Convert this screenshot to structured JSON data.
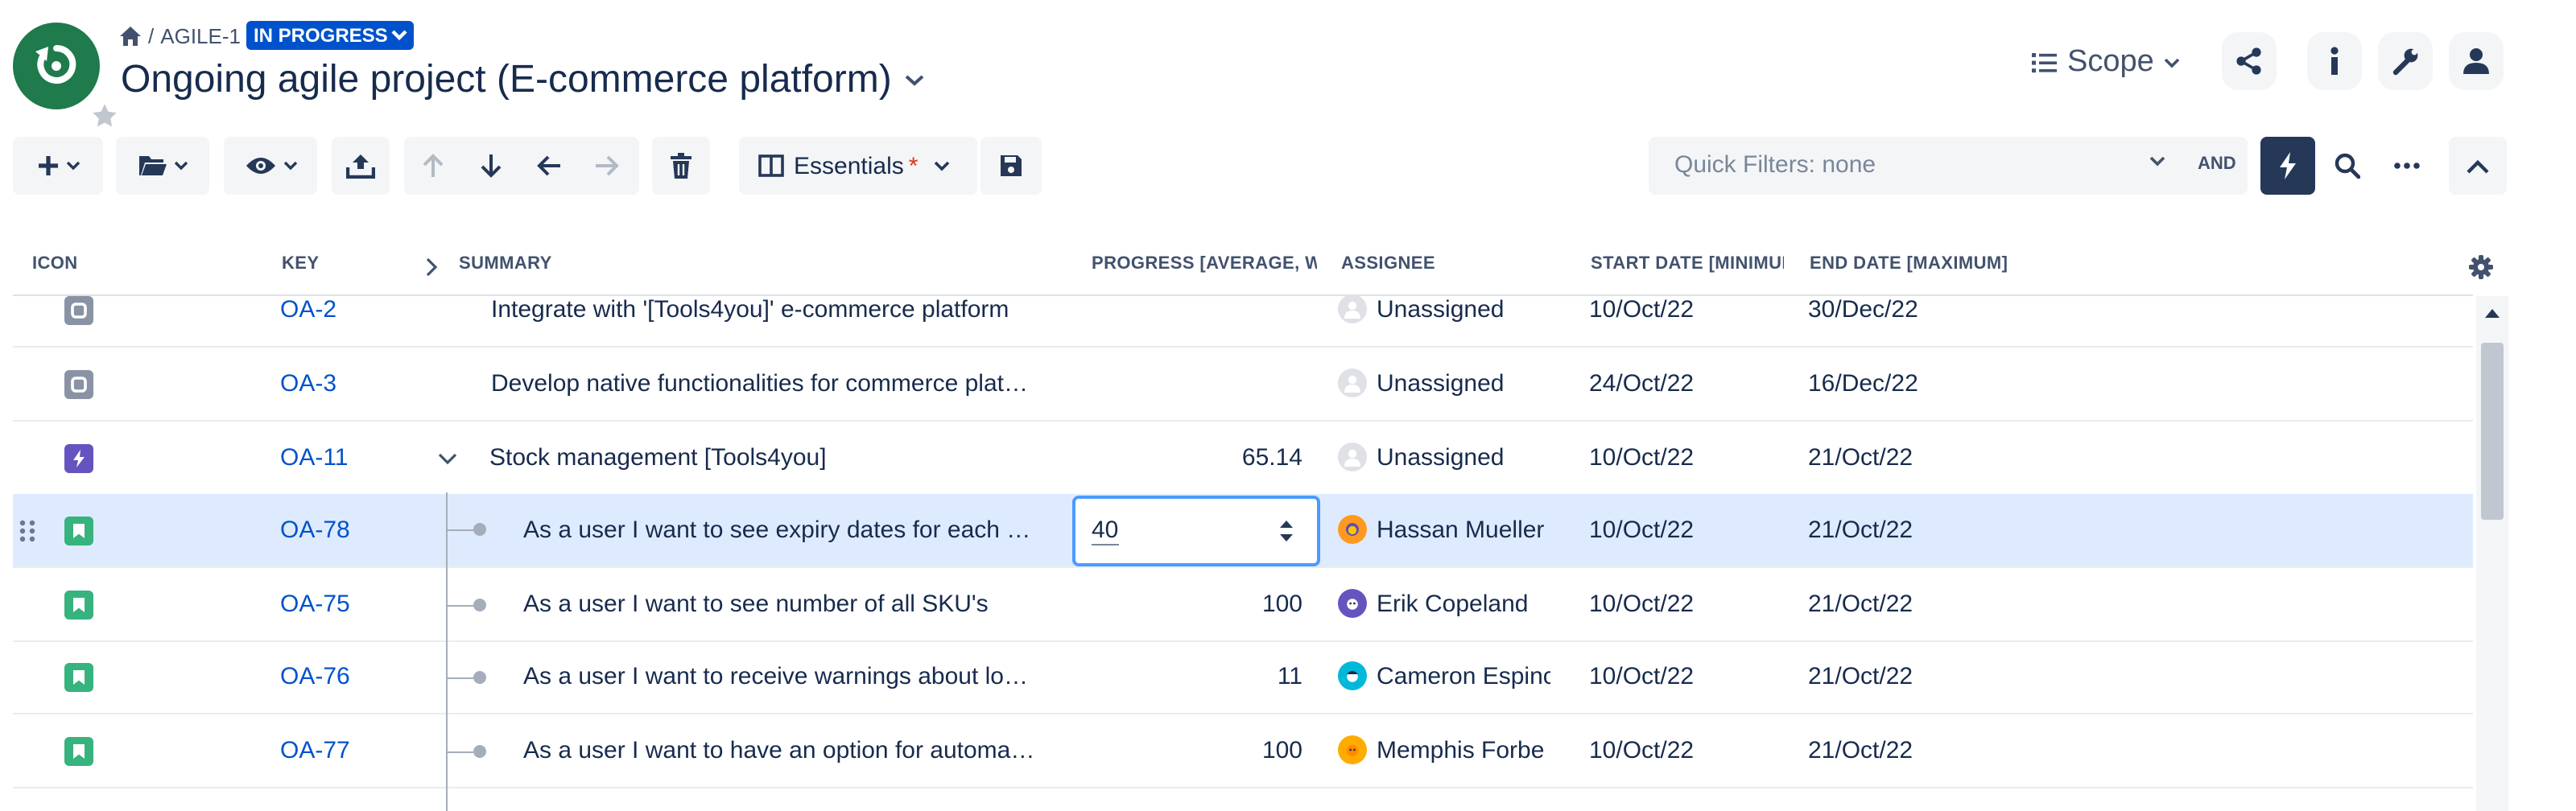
{
  "header": {
    "breadcrumb_project": "AGILE-1",
    "status": "IN PROGRESS",
    "title": "Ongoing agile project (E-commerce platform)",
    "scope_label": "Scope"
  },
  "toolbar": {
    "view_label": "Essentials",
    "view_modified_marker": "*",
    "quick_filters_placeholder": "Quick Filters: none",
    "operator": "AND"
  },
  "columns": {
    "icon": "ICON",
    "key": "KEY",
    "summary": "SUMMARY",
    "progress": "PROGRESS [AVERAGE, WITH",
    "assignee": "ASSIGNEE",
    "start_date": "START DATE [MINIMUM",
    "end_date": "END DATE [MAXIMUM]"
  },
  "rows": [
    {
      "type": "task",
      "key": "OA-2",
      "summary": "Integrate with '[Tools4you]' e-commerce platform",
      "progress": "",
      "assignee": "Unassigned",
      "start": "10/Oct/22",
      "end": "30/Dec/22"
    },
    {
      "type": "task",
      "key": "OA-3",
      "summary": "Develop native functionalities for commerce plat…",
      "progress": "",
      "assignee": "Unassigned",
      "start": "24/Oct/22",
      "end": "16/Dec/22"
    },
    {
      "type": "epic",
      "key": "OA-11",
      "summary": "Stock management [Tools4you]",
      "progress": "65.14",
      "assignee": "Unassigned",
      "start": "10/Oct/22",
      "end": "21/Oct/22"
    },
    {
      "type": "story",
      "key": "OA-78",
      "summary": "As a user I want to see expiry dates for each …",
      "progress": "40",
      "assignee": "Hassan Mueller",
      "start": "10/Oct/22",
      "end": "21/Oct/22"
    },
    {
      "type": "story",
      "key": "OA-75",
      "summary": "As a user I want to see number of all SKU's",
      "progress": "100",
      "assignee": "Erik Copeland",
      "start": "10/Oct/22",
      "end": "21/Oct/22"
    },
    {
      "type": "story",
      "key": "OA-76",
      "summary": "As a user I want to receive warnings about lo…",
      "progress": "11",
      "assignee": "Cameron Espinc",
      "start": "10/Oct/22",
      "end": "21/Oct/22"
    },
    {
      "type": "story",
      "key": "OA-77",
      "summary": "As a user I want to have an option for automa…",
      "progress": "100",
      "assignee": "Memphis Forbe",
      "start": "10/Oct/22",
      "end": "21/Oct/22"
    }
  ],
  "colors": {
    "accent": "#0052cc",
    "logo": "#1f7a4c",
    "task_icon": "#8993a4",
    "epic_icon": "#6554c0",
    "story_icon": "#36b37e",
    "selected_row": "#deebff"
  }
}
